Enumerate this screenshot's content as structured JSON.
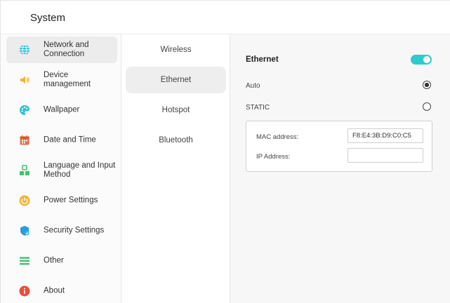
{
  "header": {
    "title": "System"
  },
  "sidebar": {
    "items": [
      {
        "label": "Network and\nConnection",
        "icon": "globe-icon",
        "color": "#2cc4d4",
        "active": true
      },
      {
        "label": "Device\nmanagement",
        "icon": "speaker-icon",
        "color": "#f2b431"
      },
      {
        "label": "Wallpaper",
        "icon": "palette-icon",
        "color": "#2cc4d4"
      },
      {
        "label": "Date and Time",
        "icon": "calendar-icon",
        "color": "#ef6a4a"
      },
      {
        "label": "Language and Input\nMethod",
        "icon": "language-icon",
        "color": "#3fc36a"
      },
      {
        "label": "Power Settings",
        "icon": "power-icon",
        "color": "#f2b431"
      },
      {
        "label": "Security Settings",
        "icon": "shield-icon",
        "color": "#2c9be0"
      },
      {
        "label": "Other",
        "icon": "list-icon",
        "color": "#3fc36a"
      },
      {
        "label": "About",
        "icon": "info-icon",
        "color": "#ef4a3a"
      }
    ]
  },
  "subnav": {
    "items": [
      {
        "label": "Wireless"
      },
      {
        "label": "Ethernet",
        "active": true
      },
      {
        "label": "Hotspot"
      },
      {
        "label": "Bluetooth"
      }
    ]
  },
  "ethernet": {
    "title": "Ethernet",
    "enabled": true,
    "accent": "#2ecbcb",
    "options": [
      {
        "label": "Auto",
        "selected": true
      },
      {
        "label": "STATIC",
        "selected": false
      }
    ],
    "mac_label": "MAC address:",
    "mac_value": "F8:E4:3B:D9:C0:C5",
    "ip_label": "IP Address:",
    "ip_value": ""
  }
}
